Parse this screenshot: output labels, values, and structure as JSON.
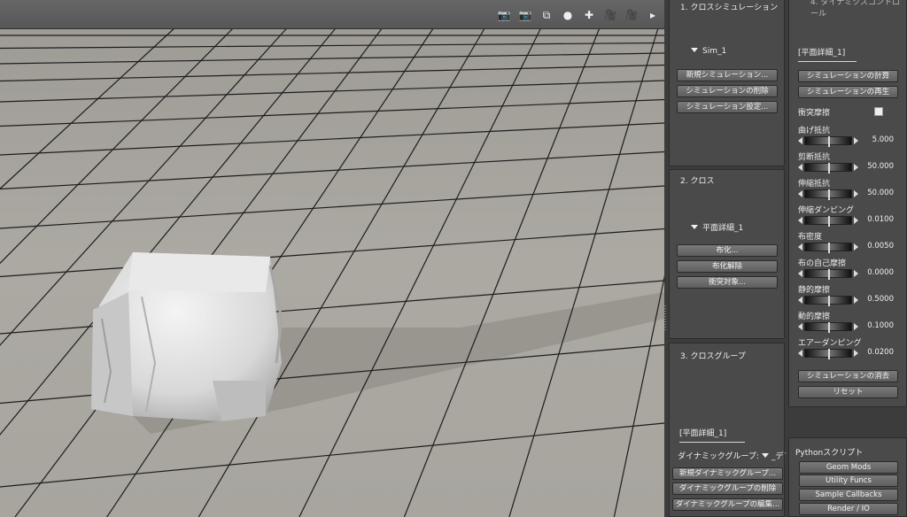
{
  "toolbar": {
    "icons": [
      "camera-icon",
      "camera-icon",
      "camera-frame-icon",
      "dot-icon",
      "globe-icon",
      "movie-camera-icon",
      "movie-camera-icon",
      "arrow-right-icon"
    ]
  },
  "cloth_sim": {
    "title": "1. クロスシミュレーション",
    "node": "Sim_1",
    "buttons": [
      "新規シミュレーション...",
      "シミュレーションの削除",
      "シミュレーション設定..."
    ]
  },
  "cloth": {
    "title": "2. クロス",
    "node": "平面詳細_1",
    "buttons": [
      "布化...",
      "布化解除",
      "衝突対象..."
    ]
  },
  "cloth_group": {
    "title": "3. クロスグループ",
    "selected": "[平面詳細_1]",
    "dynamic_label": "ダイナミックグループ:",
    "dynamic_value": "_デフォルト_",
    "buttons": [
      "新規ダイナミックグループ...",
      "ダイナミックグループの削除",
      "ダイナミックグループの編集..."
    ]
  },
  "dynamics": {
    "title": "4. ダイナミクスコントロール",
    "selected": "[平面詳細_1]",
    "compute_button": "シミュレーションの計算",
    "play_button": "シミュレーションの再生",
    "collision_friction_label": "衝突摩擦",
    "attributes": [
      {
        "label": "曲げ抵抗",
        "value": "5.000"
      },
      {
        "label": "剪断抵抗",
        "value": "50.000"
      },
      {
        "label": "伸縮抵抗",
        "value": "50.000"
      },
      {
        "label": "伸縮ダンピング",
        "value": "0.0100"
      },
      {
        "label": "布密度",
        "value": "0.0050"
      },
      {
        "label": "布の自己摩擦",
        "value": "0.0000"
      },
      {
        "label": "静的摩擦",
        "value": "0.5000"
      },
      {
        "label": "動的摩擦",
        "value": "0.1000"
      },
      {
        "label": "エアーダンピング",
        "value": "0.0200"
      }
    ],
    "clear_button": "シミュレーションの消去",
    "reset_button": "リセット"
  },
  "python": {
    "title": "Pythonスクリプト",
    "buttons": [
      "Geom Mods",
      "Utility Funcs",
      "Sample Callbacks",
      "Render / IO"
    ]
  }
}
